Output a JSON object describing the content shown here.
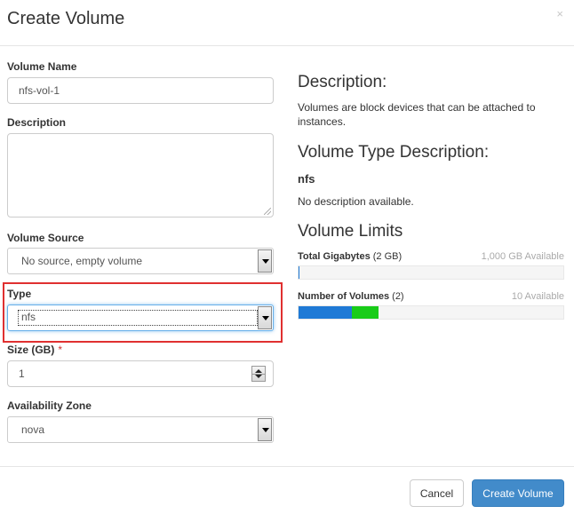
{
  "modal": {
    "title": "Create Volume",
    "close_glyph": "×"
  },
  "form": {
    "volume_name": {
      "label": "Volume Name",
      "value": "nfs-vol-1"
    },
    "description": {
      "label": "Description",
      "value": ""
    },
    "volume_source": {
      "label": "Volume Source",
      "selected": "No source, empty volume"
    },
    "type": {
      "label": "Type",
      "selected": "nfs"
    },
    "size": {
      "label": "Size (GB)",
      "required_mark": "*",
      "value": "1"
    },
    "availability_zone": {
      "label": "Availability Zone",
      "selected": "nova"
    }
  },
  "info": {
    "description_heading": "Description:",
    "description_text": "Volumes are block devices that can be attached to instances.",
    "type_heading": "Volume Type Description:",
    "type_name": "nfs",
    "type_text": "No description available.",
    "limits_heading": "Volume Limits",
    "limits": [
      {
        "name": "Total Gigabytes",
        "detail": "(2 GB)",
        "available": "1,000 GB Available",
        "used_fraction": 0.002,
        "added_fraction": 0.0
      },
      {
        "name": "Number of Volumes",
        "detail": "(2)",
        "available": "10 Available",
        "used_fraction": 0.2,
        "added_fraction": 0.1
      }
    ]
  },
  "footer": {
    "cancel_label": "Cancel",
    "create_label": "Create Volume"
  },
  "colors": {
    "primary": "#428bca",
    "bar_used": "#1f7ad6",
    "bar_added": "#19cc19",
    "highlight": "#e03030"
  },
  "icons": [
    "close-icon",
    "dropdown-arrow-icon",
    "spinner-icon",
    "resize-grip-icon"
  ]
}
